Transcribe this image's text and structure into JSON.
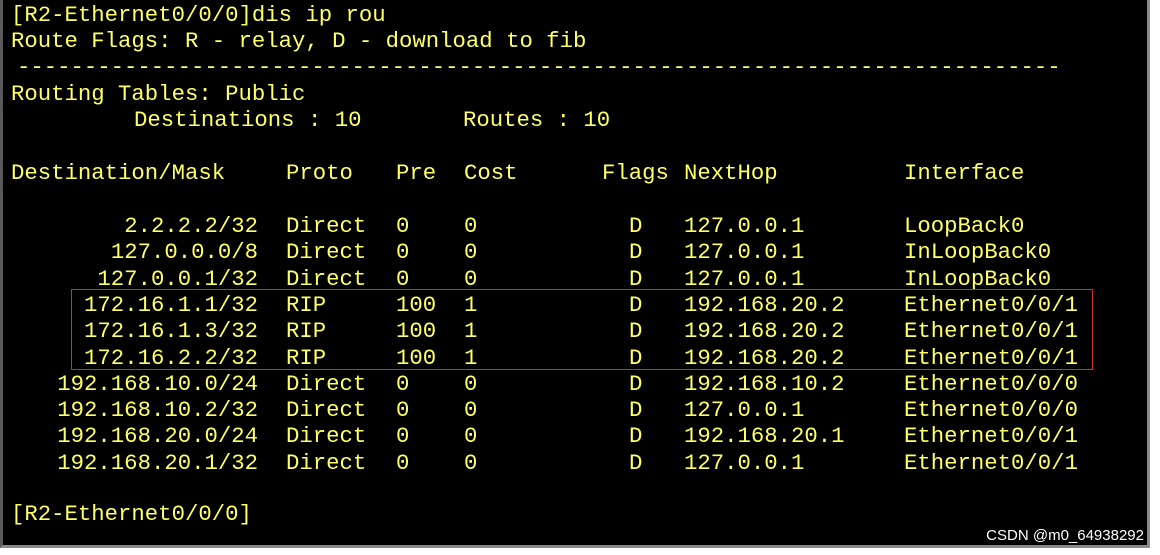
{
  "terminal": {
    "prompt_command": "[R2-Ethernet0/0/0]dis ip rou",
    "flags_legend": "Route Flags: R - relay, D - download to fib",
    "separator": "------------------------------------------------------------------------------",
    "table_title": "Routing Tables: Public",
    "destinations_label": "Destinations : 10",
    "routes_label": "Routes : 10",
    "headers": {
      "destination": "Destination/Mask",
      "proto": "Proto",
      "pre": "Pre",
      "cost": "Cost",
      "flags": "Flags",
      "nexthop": "NextHop",
      "interface": "Interface"
    },
    "routes": [
      {
        "destination": "2.2.2.2/32",
        "proto": "Direct",
        "pre": "0",
        "cost": "0",
        "flags": "D",
        "nexthop": "127.0.0.1",
        "interface": "LoopBack0"
      },
      {
        "destination": "127.0.0.0/8",
        "proto": "Direct",
        "pre": "0",
        "cost": "0",
        "flags": "D",
        "nexthop": "127.0.0.1",
        "interface": "InLoopBack0"
      },
      {
        "destination": "127.0.0.1/32",
        "proto": "Direct",
        "pre": "0",
        "cost": "0",
        "flags": "D",
        "nexthop": "127.0.0.1",
        "interface": "InLoopBack0"
      },
      {
        "destination": "172.16.1.1/32",
        "proto": "RIP",
        "pre": "100",
        "cost": "1",
        "flags": "D",
        "nexthop": "192.168.20.2",
        "interface": "Ethernet0/0/1"
      },
      {
        "destination": "172.16.1.3/32",
        "proto": "RIP",
        "pre": "100",
        "cost": "1",
        "flags": "D",
        "nexthop": "192.168.20.2",
        "interface": "Ethernet0/0/1"
      },
      {
        "destination": "172.16.2.2/32",
        "proto": "RIP",
        "pre": "100",
        "cost": "1",
        "flags": "D",
        "nexthop": "192.168.20.2",
        "interface": "Ethernet0/0/1"
      },
      {
        "destination": "192.168.10.0/24",
        "proto": "Direct",
        "pre": "0",
        "cost": "0",
        "flags": "D",
        "nexthop": "192.168.10.2",
        "interface": "Ethernet0/0/0"
      },
      {
        "destination": "192.168.10.2/32",
        "proto": "Direct",
        "pre": "0",
        "cost": "0",
        "flags": "D",
        "nexthop": "127.0.0.1",
        "interface": "Ethernet0/0/0"
      },
      {
        "destination": "192.168.20.0/24",
        "proto": "Direct",
        "pre": "0",
        "cost": "0",
        "flags": "D",
        "nexthop": "192.168.20.1",
        "interface": "Ethernet0/0/1"
      },
      {
        "destination": "192.168.20.1/32",
        "proto": "Direct",
        "pre": "0",
        "cost": "0",
        "flags": "D",
        "nexthop": "127.0.0.1",
        "interface": "Ethernet0/0/1"
      }
    ],
    "final_prompt": "[R2-Ethernet0/0/0]"
  },
  "watermark": "CSDN @m0_64938292",
  "colors": {
    "text": "#ffff66",
    "background": "#000000",
    "highlight_border": "#d03030"
  }
}
